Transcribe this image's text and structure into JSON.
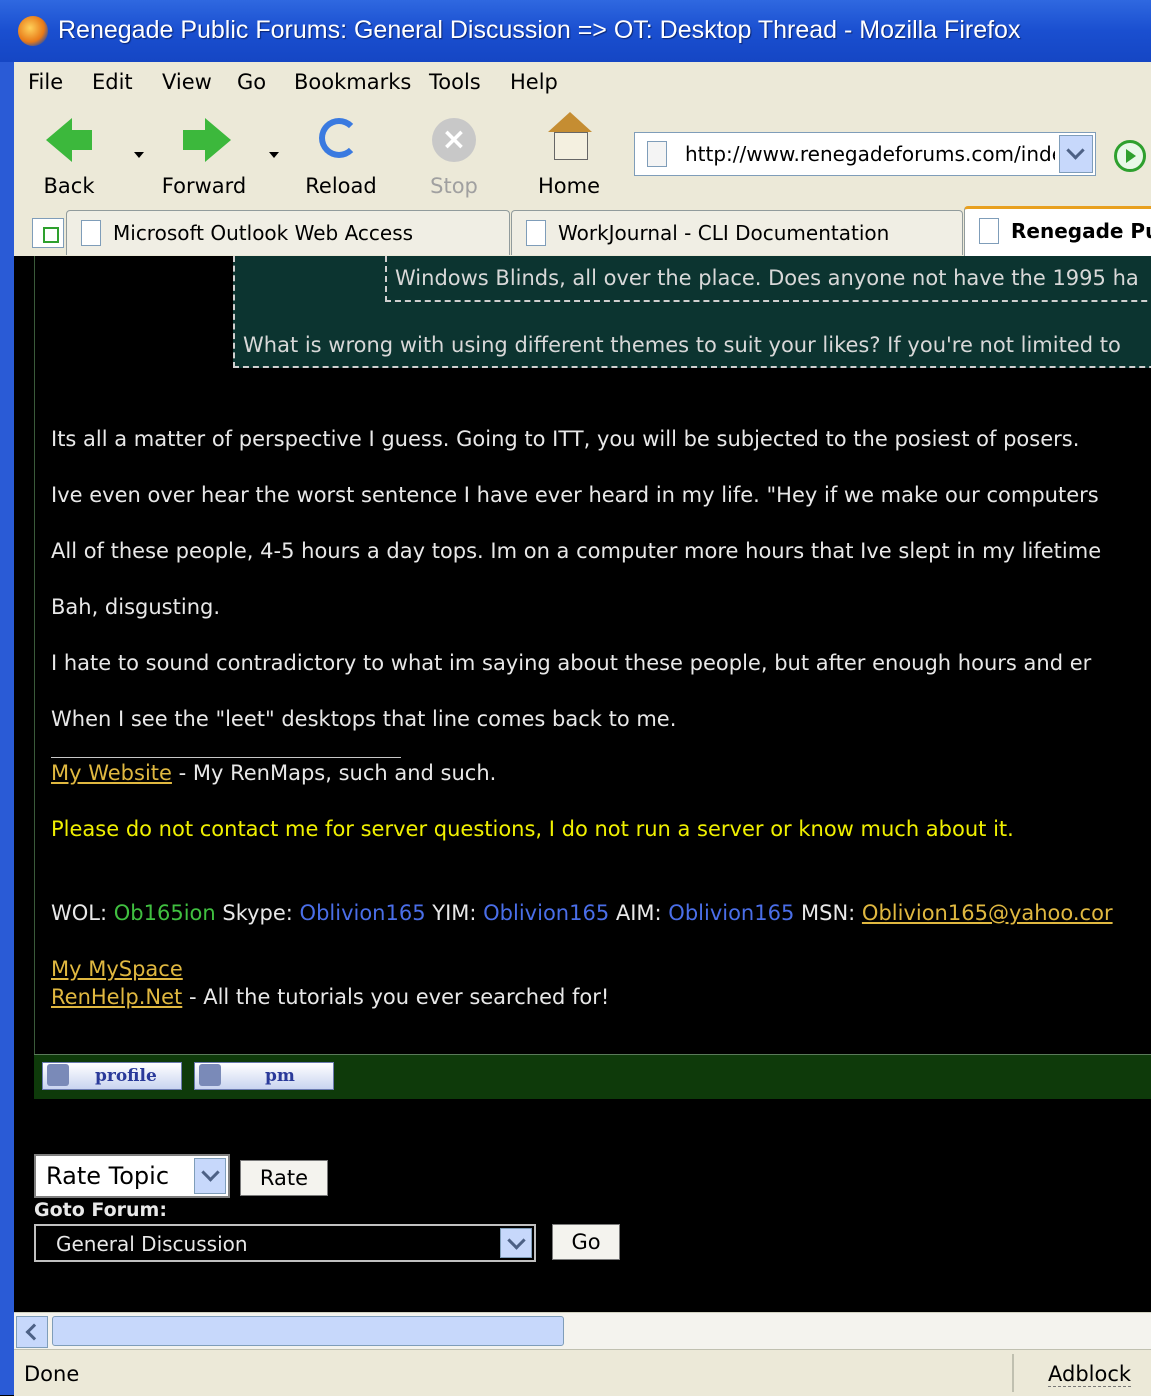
{
  "window": {
    "title": "Renegade Public Forums: General Discussion => OT: Desktop Thread - Mozilla Firefox"
  },
  "menu": [
    "File",
    "Edit",
    "View",
    "Go",
    "Bookmarks",
    "Tools",
    "Help"
  ],
  "toolbar": {
    "back": "Back",
    "forward": "Forward",
    "reload": "Reload",
    "stop": "Stop",
    "home": "Home",
    "url": "http://www.renegadeforums.com/inde"
  },
  "tabs": [
    "Microsoft Outlook Web Access",
    "WorkJournal - CLI Documentation",
    "Renegade Pu"
  ],
  "quote": {
    "inner": "Windows Blinds, all over the place. Does anyone not have the 1995 ha",
    "outer": "What is wrong with using different themes to suit your likes? If you're not limited to"
  },
  "post": {
    "p1": "Its all a matter of perspective I guess. Going to ITT, you will be subjected to the posiest of posers.",
    "p2": "Ive even over hear the worst sentence I have ever heard in my life. \"Hey if we make our computers",
    "p3": "All of these people, 4-5 hours a day tops. Im on a computer more hours that Ive slept in my lifetime",
    "p4": "Bah, disgusting.",
    "p5": "I hate to sound contradictory to what im saying about these people, but after enough hours and er",
    "p6": "When I see the \"leet\" desktops that line comes back to me."
  },
  "signature": {
    "website_link": "My Website",
    "website_text": " - My RenMaps, such and such.",
    "notice": "Please do not contact me for server questions, I do not run a server or know much about it.",
    "wol_label": "WOL: ",
    "wol_value": "Ob165ion",
    "skype_label": " Skype: ",
    "skype_value": "Oblivion165",
    "yim_label": " YIM: ",
    "yim_value": "Oblivion165",
    "aim_label": " AIM: ",
    "aim_value": "Oblivion165",
    "msn_label": " MSN: ",
    "msn_value": "Oblivion165@yahoo.cor",
    "myspace_link": "My MySpace",
    "renhelp_link": "RenHelp.Net",
    "renhelp_text": " - All the tutorials you ever searched for!"
  },
  "post_buttons": {
    "profile": "profile",
    "pm": "pm"
  },
  "controls": {
    "rate_select": "Rate Topic",
    "rate_button": "Rate",
    "goto_label": "Goto Forum:",
    "forum_select": "General Discussion",
    "go_button": "Go"
  },
  "status": {
    "text": "Done",
    "adblock": "Adblock"
  }
}
